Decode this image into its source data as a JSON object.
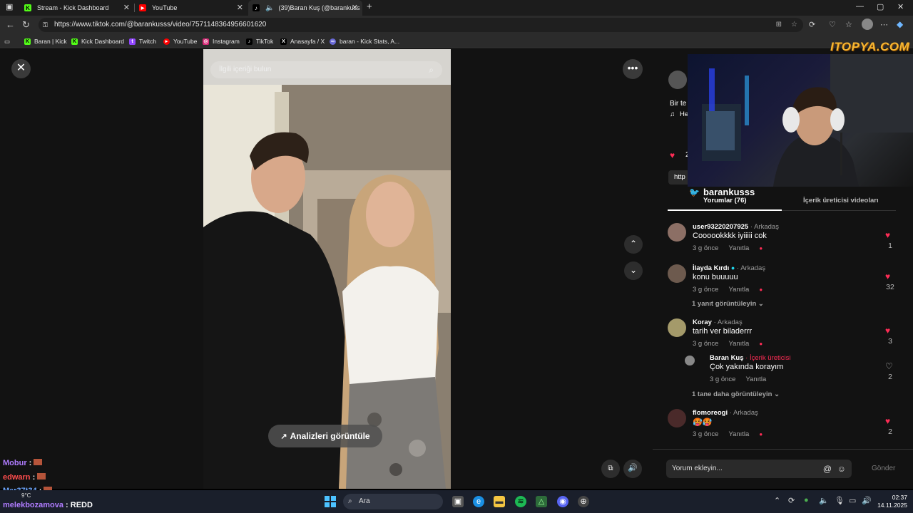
{
  "tabs": [
    {
      "title": "Stream - Kick Dashboard"
    },
    {
      "title": "YouTube"
    },
    {
      "title": "(39)Baran Kuş (@barankuss"
    }
  ],
  "browser": {
    "url": "https://www.tiktok.com/@barankusss/video/7571148364956601620"
  },
  "bookmarks": [
    "Baran | Kick",
    "Kick Dashboard",
    "Twitch",
    "YouTube",
    "Instagram",
    "TikTok",
    "Anasayfa / X",
    "baran - Kick Stats, A..."
  ],
  "video": {
    "search_placeholder": "İlgili içeriği bulun",
    "analytics_label": "Analizleri görüntüle"
  },
  "overlay": {
    "brand": "ITOPYA.COM",
    "twitter_handle": "barankusss"
  },
  "panel": {
    "caption_partial": "Bir te",
    "music_partial": "He",
    "likes_partial": "2",
    "link_partial": "http",
    "tab_comments": "Yorumlar (76)",
    "tab_creator_videos": "İçerik üreticisi videoları",
    "comment_placeholder": "Yorum ekleyin...",
    "send_label": "Gönder"
  },
  "comments": [
    {
      "user": "user93220207925",
      "tag": " · Arkadaş",
      "text": "Coooookkkk iyiiiii cok",
      "time": "3 g önce",
      "reply": "Yanıtla",
      "likes": "1"
    },
    {
      "user": "İlayda Kırdı",
      "tag": " · Arkadaş",
      "text": "konu buuuuu",
      "time": "3 g önce",
      "reply": "Yanıtla",
      "likes": "32",
      "view_replies": "1 yanıt görüntüleyin"
    },
    {
      "user": "Koray",
      "tag": " · Arkadaş",
      "text": "tarih ver biladerrr",
      "time": "3 g önce",
      "reply": "Yanıtla",
      "likes": "3",
      "reply_item": {
        "user": "Baran Kuş",
        "tag": " · İçerik üreticisi",
        "text": "Çok yakında korayım",
        "time": "3 g önce",
        "reply": "Yanıtla",
        "likes": "2"
      },
      "view_more": "1 tane daha görüntüleyin"
    },
    {
      "user": "flomoreogi",
      "tag": " · Arkadaş",
      "text": "🥵🥵",
      "time": "3 g önce",
      "reply": "Yanıtla",
      "likes": "2"
    }
  ],
  "chat": [
    {
      "user": "Mobur"
    },
    {
      "user": "edwarn"
    },
    {
      "user": "Mer37t34"
    },
    {
      "user": "melekbozamova",
      "message": "REDD"
    }
  ],
  "taskbar": {
    "weather": "9°C",
    "search_label": "Ara",
    "time": "02:37",
    "date": "14.11.2025"
  }
}
